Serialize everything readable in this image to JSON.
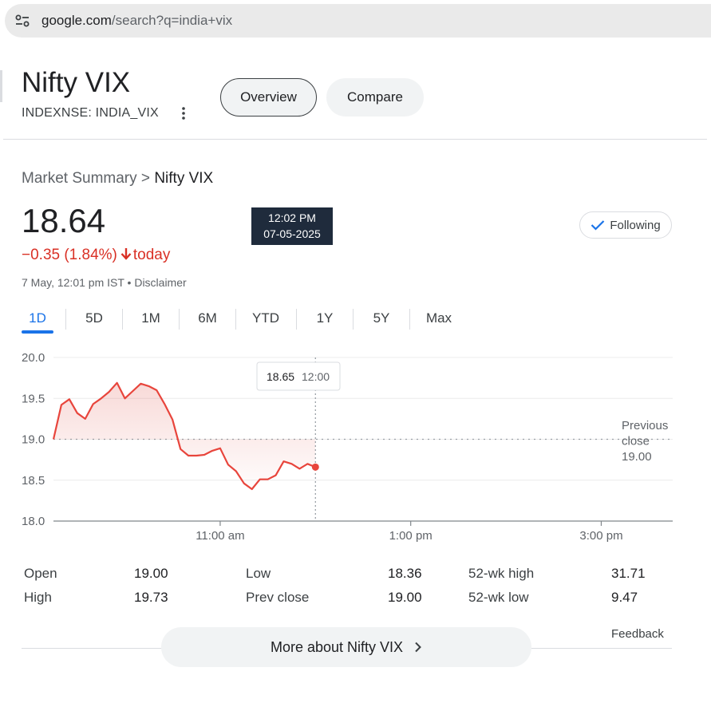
{
  "browser": {
    "url_host": "google.com",
    "url_path": "/search?q=india+vix"
  },
  "header": {
    "title": "Nifty VIX",
    "ticker": "INDEXNSE: INDIA_VIX",
    "tabs": [
      {
        "label": "Overview"
      },
      {
        "label": "Compare"
      }
    ]
  },
  "summary": {
    "breadcrumb_root": "Market Summary",
    "breadcrumb_sep": ">",
    "breadcrumb_current": "Nifty VIX",
    "price": "18.64",
    "change_text": "−0.35 (1.84%)",
    "change_suffix": "today",
    "asof": "7 May, 12:01 pm IST • Disclaimer",
    "hover_time": "12:02 PM",
    "hover_date": "07-05-2025",
    "following_label": "Following"
  },
  "ranges": [
    "1D",
    "5D",
    "1M",
    "6M",
    "YTD",
    "1Y",
    "5Y",
    "Max"
  ],
  "active_range": "1D",
  "colors": {
    "accent": "#1a73e8",
    "down": "#d93025",
    "tooltip_bg": "#1f2b3c"
  },
  "chart_data": {
    "type": "area",
    "y_ticks": [
      "20.0",
      "19.5",
      "19.0",
      "18.5",
      "18.0"
    ],
    "ylim": [
      18.0,
      20.0
    ],
    "x_ticks": [
      "11:00 am",
      "1:00 pm",
      "3:00 pm"
    ],
    "tooltip_value": "18.65",
    "tooltip_time": "12:00",
    "prev_close_label": [
      "Previous",
      "close",
      "19.00"
    ],
    "prev_close": 19.0,
    "series": [
      {
        "x_min": [
          555,
          560,
          565,
          570,
          575,
          580,
          585,
          590,
          595,
          600,
          605,
          610,
          615,
          620,
          625,
          630,
          635,
          640,
          645,
          650,
          655,
          660,
          665,
          670,
          675,
          680,
          685,
          690,
          695,
          700,
          705,
          710,
          715,
          720
        ],
        "values": [
          19.0,
          19.42,
          19.49,
          19.32,
          19.25,
          19.43,
          19.5,
          19.58,
          19.69,
          19.5,
          19.59,
          19.68,
          19.65,
          19.6,
          19.43,
          19.24,
          18.88,
          18.8,
          18.8,
          18.81,
          18.86,
          18.89,
          18.69,
          18.61,
          18.46,
          18.39,
          18.51,
          18.51,
          18.56,
          18.73,
          18.7,
          18.64,
          18.7,
          18.66
        ]
      }
    ],
    "x_domain_min": [
      555,
      945
    ]
  },
  "stats": [
    [
      {
        "label": "Open",
        "value": "19.00"
      },
      {
        "label": "Low",
        "value": "18.36"
      },
      {
        "label": "52-wk high",
        "value": "31.71"
      }
    ],
    [
      {
        "label": "High",
        "value": "19.73"
      },
      {
        "label": "Prev close",
        "value": "19.00"
      },
      {
        "label": "52-wk low",
        "value": "9.47"
      }
    ]
  ],
  "footer": {
    "feedback": "Feedback",
    "more_label": "More about Nifty VIX"
  }
}
